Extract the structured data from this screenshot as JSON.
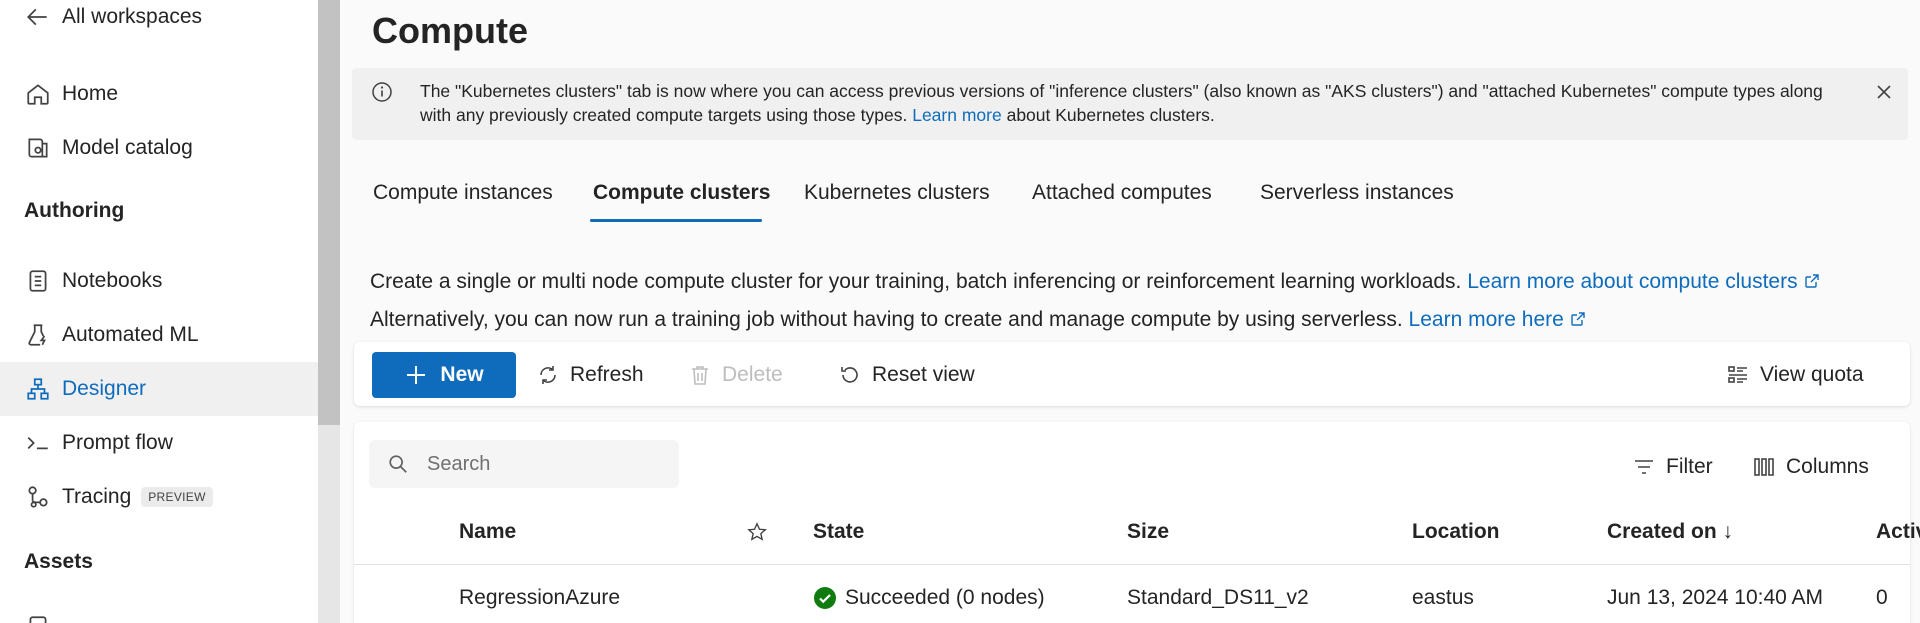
{
  "sidebar": {
    "back_label": "All workspaces",
    "home": "Home",
    "model_catalog": "Model catalog",
    "authoring_header": "Authoring",
    "notebooks": "Notebooks",
    "automated_ml": "Automated ML",
    "designer": "Designer",
    "prompt_flow": "Prompt flow",
    "tracing": "Tracing",
    "tracing_badge": "PREVIEW",
    "assets_header": "Assets"
  },
  "page": {
    "title": "Compute"
  },
  "banner": {
    "text": "The \"Kubernetes clusters\" tab is now where you can access previous versions of \"inference clusters\" (also known as \"AKS clusters\") and \"attached Kubernetes\" compute types along with any previously created compute targets using those types.",
    "link": "Learn more",
    "tail": "about Kubernetes clusters."
  },
  "tabs": [
    "Compute instances",
    "Compute clusters",
    "Kubernetes clusters",
    "Attached computes",
    "Serverless instances"
  ],
  "description": {
    "line1": "Create a single or multi node compute cluster for your training, batch inferencing or reinforcement learning workloads.",
    "line1_link": "Learn more about compute clusters",
    "line2": "Alternatively, you can now run a training job without having to create and manage compute by using serverless.",
    "line2_link": "Learn more here"
  },
  "toolbar": {
    "new": "New",
    "refresh": "Refresh",
    "delete": "Delete",
    "reset_view": "Reset view",
    "view_quota": "View quota"
  },
  "table": {
    "search_placeholder": "Search",
    "filter": "Filter",
    "columns_btn": "Columns",
    "headers": {
      "name": "Name",
      "state": "State",
      "size": "Size",
      "location": "Location",
      "created_on": "Created on",
      "created_sort": "↓",
      "active": "Activ"
    },
    "rows": [
      {
        "name": "RegressionAzure",
        "state": "Succeeded (0 nodes)",
        "size": "Standard_DS11_v2",
        "location": "eastus",
        "created_on": "Jun 13, 2024 10:40 AM",
        "active": "0"
      }
    ]
  },
  "colors": {
    "accent": "#0f6cbd",
    "success": "#107c10"
  }
}
